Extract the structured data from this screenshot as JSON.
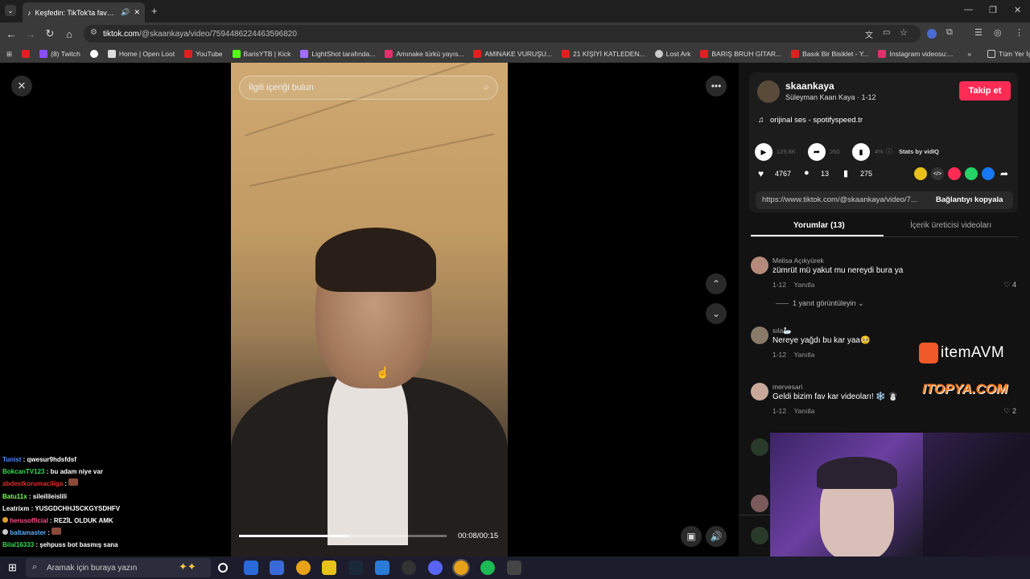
{
  "browser": {
    "tab_title": "Keşfedin: TikTok'ta favori vi",
    "url_host": "tiktok.com",
    "url_path": "/@skaankaya/video/7594486224463596820",
    "bookmarks": [
      "(8) Twitch",
      "Home | Open Loot",
      "YouTube",
      "BarisYTB | Kick",
      "LightShot tarafında...",
      "Amınake türkü yayıs...",
      "AMINAKE VURUŞU...",
      "21 KİŞİYİ KATLEDEN...",
      "Lost Ark",
      "BARIŞ BRUH GİTAR...",
      "Basık Bir Bisiklet - Y...",
      "Instagram videosu:..."
    ],
    "bookmarks_all": "Tüm Yer İşaretleri"
  },
  "video": {
    "search_placeholder": "İlgili içeriği bulun",
    "time": "00:08/00:15",
    "progress": 0.53
  },
  "author": {
    "username": "skaankaya",
    "meta": "Süleyman Kaan Kaya · 1-12",
    "follow": "Takip et",
    "sound": "orijinal ses - spotifyspeed.tr"
  },
  "stats": {
    "plays": "129.8K",
    "shares_small": "260",
    "pct": "4%",
    "stats_by": "Stats by vidIQ",
    "likes": "4767",
    "comments": "13",
    "saves": "275"
  },
  "link": {
    "url": "https://www.tiktok.com/@skaankaya/video/7...",
    "copy": "Bağlantıyı kopyala"
  },
  "tabs": {
    "comments": "Yorumlar (13)",
    "creator": "İçerik üreticisi videoları"
  },
  "comments": [
    {
      "name": "Melisa Açıkyürek",
      "text": "zümrüt mü yakut mu nereydi bura ya",
      "date": "1-12",
      "reply": "Yanıtla",
      "likes": "4",
      "replies": "1 yanıt görüntüleyin"
    },
    {
      "name": "sıla🦢",
      "text": "Nereye yağdı bu kar yaa🥺",
      "date": "1-12",
      "reply": "Yanıtla",
      "likes": ""
    },
    {
      "name": "mervesari",
      "text": "Geldi bizim fav kar videoları! ❄️ ☃️",
      "date": "1-12",
      "reply": "Yanıtla",
      "likes": "2"
    }
  ],
  "overlays": {
    "itemavm": "itemAVM",
    "itopya": "ITOPYA.COM"
  },
  "chat": [
    {
      "user": "Tunist",
      "msg": "qwesur9hdsfdsf",
      "color": "#4a8cff"
    },
    {
      "user": "BokcanTV123",
      "msg": "bu adam niye var",
      "color": "#33dd55"
    },
    {
      "user": "abdestkorumaciliga",
      "msg": "",
      "color": "#e03030"
    },
    {
      "user": "Batu11x",
      "msg": "sileilileislili",
      "color": "#7dff5a"
    },
    {
      "user": "Leatrixm",
      "msg": "YUSGDCHHJSCKGYSDHFV",
      "color": "#ffffff"
    },
    {
      "user": "herusofficial",
      "msg": "REZİL OLDUK AMK",
      "color": "#ff4d8a"
    },
    {
      "user": "baltamaster",
      "msg": "",
      "color": "#5ab0ff"
    },
    {
      "user": "Bilal16333",
      "msg": "şehpuss bot basmış sana",
      "color": "#33dd55"
    }
  ],
  "taskbar": {
    "search": "Aramak için buraya yazın"
  }
}
